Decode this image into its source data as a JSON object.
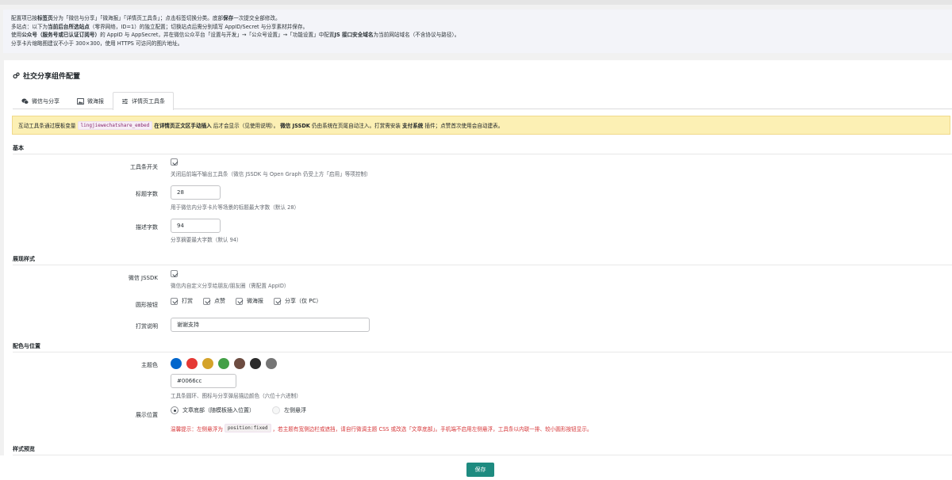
{
  "notice": {
    "l1a": "配置项已按",
    "l1b": "标签页",
    "l1c": "分为「微信与分享」「微海报」「详情页工具条」；点击标签切换分类。底部",
    "l1d": "保存",
    "l1e": "一次提交全部修改。",
    "l2a": "多站点：以下为",
    "l2b": "当前后台所选站点",
    "l2c": "（零界网络，ID=1）的独立配置；切换站点后需分别填写 AppID/Secret 与分享素材并保存。",
    "l3a": "使用",
    "l3b": "公众号（服务号或已认证订阅号）",
    "l3c": "的 AppID 与 AppSecret，并在微信公众平台「设置与开发」→「公众号设置」→「功能设置」中配置",
    "l3d": "JS 接口安全域名",
    "l3e": "为当前网站域名（不含协议与路径）。",
    "l4": "分享卡片缩略图建议不小于 300×300，使用 HTTPS 可访问的图片地址。"
  },
  "card": {
    "title": "社交分享组件配置"
  },
  "tabs": [
    {
      "label": "微信与分享"
    },
    {
      "label": "微海报"
    },
    {
      "label": "详情页工具条"
    }
  ],
  "warn": {
    "a": "互动工具条通过模板变量",
    "code": "lingjiewechatshare_embed",
    "b": "在详情页正文区手动插入",
    "c": "后才会显示（见使用说明）。",
    "d": "微信 JSSDK",
    "e": "仍由系统在页尾自动注入。打赏需安装",
    "f": "支付系统",
    "g": "插件；点赞首次使用会自动建表。"
  },
  "sections": {
    "basic": "基本",
    "display": "展现样式",
    "color": "配色与位置",
    "preview": "样式预览"
  },
  "fields": {
    "toolbar_switch": {
      "label": "工具条开关",
      "desc": "关闭后前端不输出工具条（微信 JSSDK 与 Open Graph 仍受上方「启用」等项控制）"
    },
    "title_len": {
      "label": "标题字数",
      "value": "28",
      "desc": "用于微信内分享卡片等场景的标题最大字数（默认 28）"
    },
    "desc_len": {
      "label": "描述字数",
      "value": "94",
      "desc": "分享摘要最大字数（默认 94）"
    },
    "jssdk": {
      "label": "微信 JSSDK",
      "desc": "微信内自定义分享给朋友/朋友圈（需配置 AppID）"
    },
    "buttons": {
      "label": "圆形按钮",
      "items": [
        "打赏",
        "点赞",
        "微海报",
        "分享（仅 PC）"
      ]
    },
    "reward_text": {
      "label": "打赏说明",
      "value": "谢谢支持"
    },
    "theme": {
      "label": "主题色",
      "colors": [
        "#0066cc",
        "#e53935",
        "#d4a32a",
        "#43a047",
        "#6d4c41",
        "#2b2b2b",
        "#757575"
      ],
      "value": "#0066cc",
      "desc": "工具条圆环、图标与分享弹层描边颜色（六位十六进制）"
    },
    "position": {
      "label": "展示位置",
      "opt1": "文章底部（随模板插入位置）",
      "opt2": "左侧悬浮"
    }
  },
  "tip": {
    "a": "温馨提示：左侧悬浮为",
    "code": "position:fixed",
    "b": "，若主题有宽侧边栏或遮挡，请自行微调主题 CSS 或改选「文章底部」。手机端不启用左侧悬浮，工具条以内联一排、较小圆形按钮显示。"
  },
  "save_label": "保存"
}
